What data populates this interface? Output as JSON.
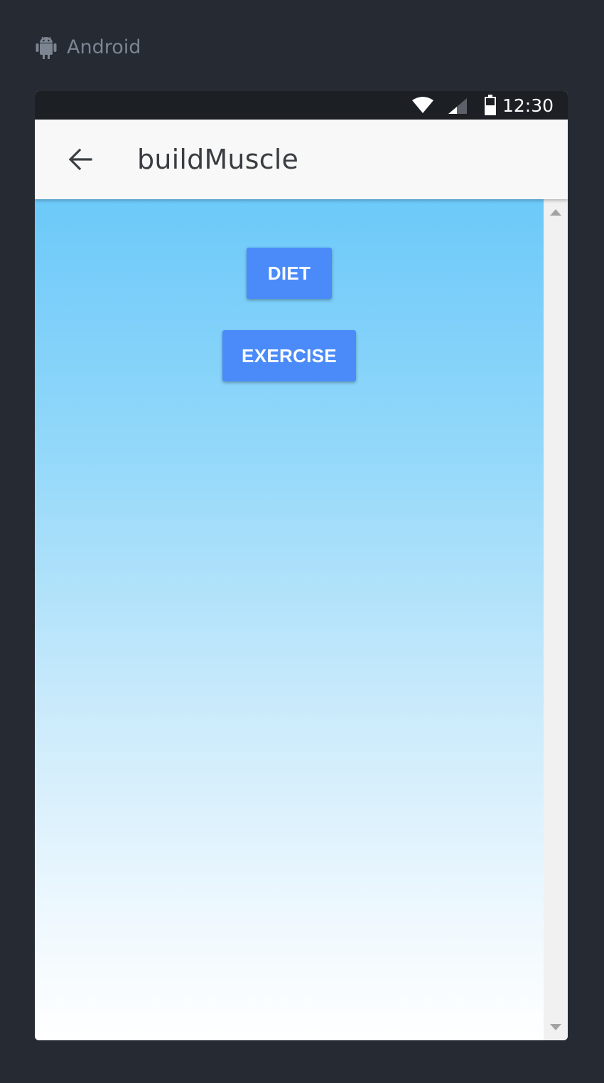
{
  "platform": {
    "label": "Android",
    "icon": "android-icon"
  },
  "status_bar": {
    "time": "12:30",
    "icons": [
      "wifi-icon",
      "signal-icon",
      "battery-icon"
    ]
  },
  "app_bar": {
    "back_icon": "arrow-back-icon",
    "title": "buildMuscle"
  },
  "content": {
    "buttons": [
      {
        "label": "DIET"
      },
      {
        "label": "EXERCISE"
      }
    ]
  },
  "colors": {
    "background": "#252a33",
    "status_bar": "#1c1f24",
    "app_bar": "#f8f8f8",
    "button": "#4b8bf9",
    "gradient_top": "#6cc9f9",
    "gradient_bottom": "#ffffff"
  }
}
